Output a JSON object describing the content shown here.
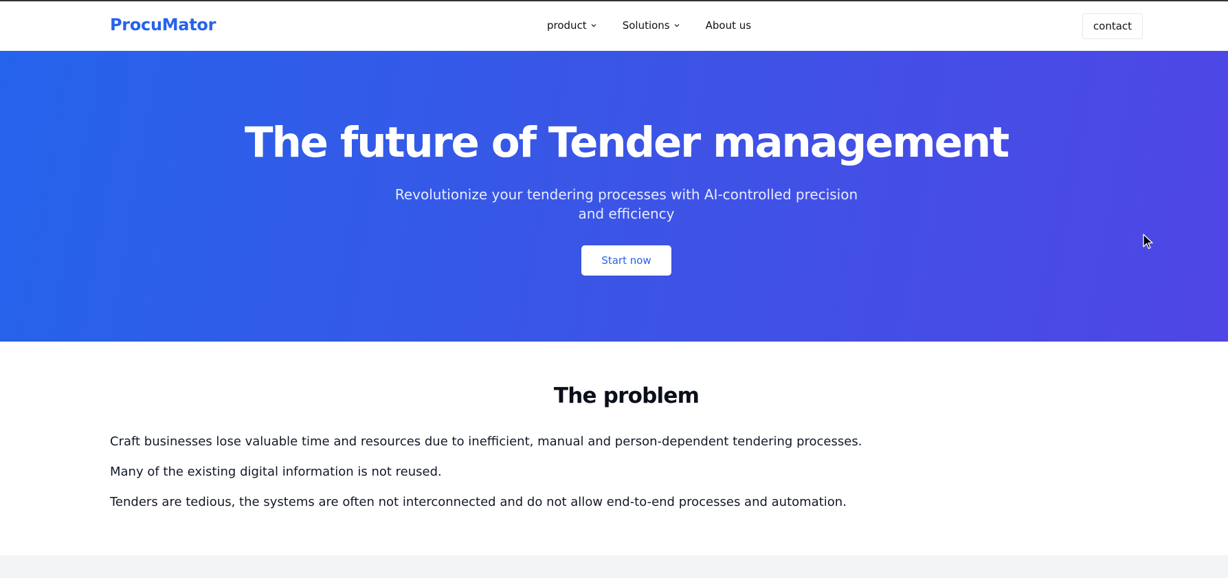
{
  "header": {
    "logo": "ProcuMator",
    "nav": [
      {
        "label": "product",
        "has_dropdown": true,
        "icon": "chevron-down-icon"
      },
      {
        "label": "Solutions",
        "has_dropdown": true,
        "icon": "chevron-down-icon"
      },
      {
        "label": "About us",
        "has_dropdown": false
      }
    ],
    "contact_label": "contact"
  },
  "hero": {
    "title": "The future of Tender management",
    "subtitle": "Revolutionize your tendering processes with AI-controlled precision and efficiency",
    "cta_label": "Start now"
  },
  "problem": {
    "title": "The problem",
    "paragraphs": [
      "Craft businesses lose valuable time and resources due to inefficient, manual and person-dependent tendering processes.",
      "Many of the existing digital information is not reused.",
      "Tenders are tedious, the systems are often not interconnected and do not allow end-to-end processes and automation."
    ]
  },
  "colors": {
    "brand": "#2563eb",
    "hero_gradient_start": "#2563eb",
    "hero_gradient_end": "#4f46e5",
    "footer_band": "#f3f4f6"
  },
  "cursor": {
    "icon": "mouse-pointer-icon"
  }
}
